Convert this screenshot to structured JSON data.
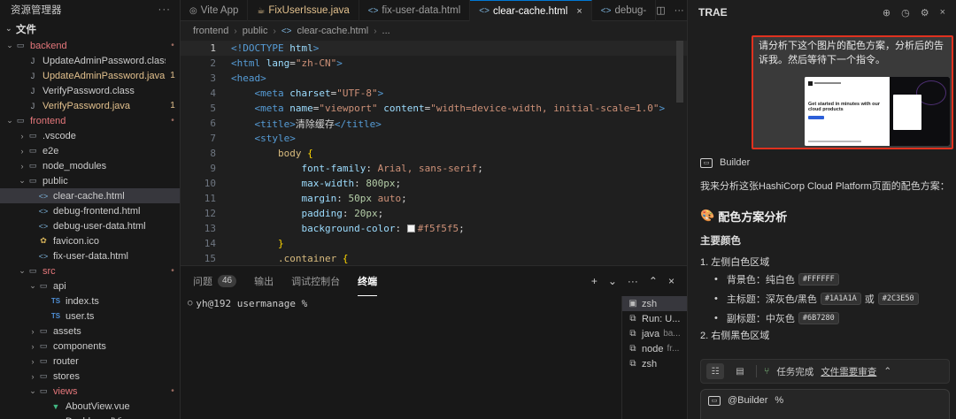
{
  "sidebar": {
    "title": "资源管理器",
    "more": "···",
    "section": "文件",
    "items": [
      {
        "label": "backend",
        "type": "folder",
        "open": true,
        "depth": 0,
        "color": "red",
        "badge": "•"
      },
      {
        "label": "UpdateAdminPassword.class",
        "type": "java",
        "depth": 1,
        "color": "",
        "badge": ""
      },
      {
        "label": "UpdateAdminPassword.java",
        "type": "java",
        "depth": 1,
        "color": "mod",
        "badge": "1"
      },
      {
        "label": "VerifyPassword.class",
        "type": "java",
        "depth": 1,
        "color": "",
        "badge": ""
      },
      {
        "label": "VerifyPassword.java",
        "type": "java",
        "depth": 1,
        "color": "mod",
        "badge": "1"
      },
      {
        "label": "frontend",
        "type": "folder",
        "open": true,
        "depth": 0,
        "color": "red",
        "badge": "•"
      },
      {
        "label": ".vscode",
        "type": "folder",
        "open": false,
        "depth": 1,
        "color": "",
        "badge": ""
      },
      {
        "label": "e2e",
        "type": "folder",
        "open": false,
        "depth": 1,
        "color": "",
        "badge": ""
      },
      {
        "label": "node_modules",
        "type": "folder",
        "open": false,
        "depth": 1,
        "color": "",
        "badge": ""
      },
      {
        "label": "public",
        "type": "folder",
        "open": true,
        "depth": 1,
        "color": "",
        "badge": ""
      },
      {
        "label": "clear-cache.html",
        "type": "html",
        "depth": 2,
        "color": "",
        "badge": "",
        "selected": true
      },
      {
        "label": "debug-frontend.html",
        "type": "html",
        "depth": 2,
        "color": "",
        "badge": ""
      },
      {
        "label": "debug-user-data.html",
        "type": "html",
        "depth": 2,
        "color": "",
        "badge": ""
      },
      {
        "label": "favicon.ico",
        "type": "ico",
        "depth": 2,
        "color": "",
        "badge": ""
      },
      {
        "label": "fix-user-data.html",
        "type": "html",
        "depth": 2,
        "color": "",
        "badge": ""
      },
      {
        "label": "src",
        "type": "folder",
        "open": true,
        "depth": 1,
        "color": "red",
        "badge": "•"
      },
      {
        "label": "api",
        "type": "folder",
        "open": true,
        "depth": 2,
        "color": "",
        "badge": ""
      },
      {
        "label": "index.ts",
        "type": "ts",
        "depth": 3,
        "color": "",
        "badge": ""
      },
      {
        "label": "user.ts",
        "type": "ts",
        "depth": 3,
        "color": "",
        "badge": ""
      },
      {
        "label": "assets",
        "type": "folder",
        "open": false,
        "depth": 2,
        "color": "",
        "badge": ""
      },
      {
        "label": "components",
        "type": "folder",
        "open": false,
        "depth": 2,
        "color": "",
        "badge": ""
      },
      {
        "label": "router",
        "type": "folder",
        "open": false,
        "depth": 2,
        "color": "",
        "badge": ""
      },
      {
        "label": "stores",
        "type": "folder",
        "open": false,
        "depth": 2,
        "color": "",
        "badge": ""
      },
      {
        "label": "views",
        "type": "folder",
        "open": true,
        "depth": 2,
        "color": "red",
        "badge": "•"
      },
      {
        "label": "AboutView.vue",
        "type": "vue",
        "depth": 3,
        "color": "",
        "badge": ""
      },
      {
        "label": "DashboardView.vue",
        "type": "vue",
        "depth": 3,
        "color": "",
        "badge": ""
      }
    ]
  },
  "editor": {
    "tabs": [
      {
        "label": "Vite App",
        "icon": "globe-icon",
        "active": false,
        "modified": false
      },
      {
        "label": "FixUserIssue.java",
        "icon": "java-icon",
        "active": false,
        "modified": true
      },
      {
        "label": "fix-user-data.html",
        "icon": "html-icon",
        "active": false,
        "modified": false
      },
      {
        "label": "clear-cache.html",
        "icon": "html-icon",
        "active": true,
        "modified": false
      },
      {
        "label": "debug-",
        "icon": "html-icon",
        "active": false,
        "modified": false
      }
    ],
    "close_glyph": "×",
    "tab_more": "···",
    "breadcrumb": [
      "frontend",
      "public",
      "clear-cache.html",
      "..."
    ],
    "current_line": 1,
    "lines": [
      {
        "n": "1",
        "html": "<span class='t-tag'>&lt;!DOCTYPE</span> <span class='t-attr'>html</span><span class='t-tag'>&gt;</span>"
      },
      {
        "n": "2",
        "html": "<span class='t-tag'>&lt;html</span> <span class='t-attr'>lang</span>=<span class='t-str'>\"zh-CN\"</span><span class='t-tag'>&gt;</span>"
      },
      {
        "n": "3",
        "html": "<span class='t-tag'>&lt;head&gt;</span>"
      },
      {
        "n": "4",
        "html": "    <span class='t-tag'>&lt;meta</span> <span class='t-attr'>charset</span>=<span class='t-str'>\"UTF-8\"</span><span class='t-tag'>&gt;</span>"
      },
      {
        "n": "5",
        "html": "    <span class='t-tag'>&lt;meta</span> <span class='t-attr'>name</span>=<span class='t-str'>\"viewport\"</span> <span class='t-attr'>content</span>=<span class='t-str'>\"width=device-width, initial-scale=1.0\"</span><span class='t-tag'>&gt;</span>"
      },
      {
        "n": "6",
        "html": "    <span class='t-tag'>&lt;title&gt;</span>清除缓存<span class='t-tag'>&lt;/title&gt;</span>"
      },
      {
        "n": "7",
        "html": "    <span class='t-tag'>&lt;style&gt;</span>"
      },
      {
        "n": "8",
        "html": "        <span class='t-sel'>body</span> <span class='t-br'>{</span>"
      },
      {
        "n": "9",
        "html": "            <span class='t-prop'>font-family</span>: <span class='t-val'>Arial, sans-serif</span>;"
      },
      {
        "n": "10",
        "html": "            <span class='t-prop'>max-width</span>: <span class='t-num'>800px</span>;"
      },
      {
        "n": "11",
        "html": "            <span class='t-prop'>margin</span>: <span class='t-num'>50px</span> <span class='t-val'>auto</span>;"
      },
      {
        "n": "12",
        "html": "            <span class='t-prop'>padding</span>: <span class='t-num'>20px</span>;"
      },
      {
        "n": "13",
        "html": "            <span class='t-prop'>background-color</span>: <span class='swatch'></span><span class='t-val'>#f5f5f5</span>;"
      },
      {
        "n": "14",
        "html": "        <span class='t-br'>}</span>"
      },
      {
        "n": "15",
        "html": "        <span class='t-sel'>.container</span> <span class='t-br'>{</span>"
      }
    ]
  },
  "panel": {
    "tabs": [
      {
        "label": "问题",
        "badge": "46",
        "active": false
      },
      {
        "label": "输出",
        "badge": "",
        "active": false
      },
      {
        "label": "调试控制台",
        "badge": "",
        "active": false
      },
      {
        "label": "终端",
        "badge": "",
        "active": true
      }
    ],
    "actions": {
      "add": "+",
      "dropdown": "⌄",
      "more": "···",
      "maximize": "⌃",
      "close": "×"
    },
    "prompt": "yh@192 usermanage %",
    "terminals": [
      {
        "label": "zsh",
        "sub": "",
        "active": true
      },
      {
        "label": "Run: U...",
        "sub": "",
        "active": false
      },
      {
        "label": "java",
        "sub": "ba...",
        "active": false
      },
      {
        "label": "node",
        "sub": "fr...",
        "active": false
      },
      {
        "label": "zsh",
        "sub": "",
        "active": false
      }
    ]
  },
  "chat": {
    "title": "TRAE",
    "user_message": "请分析下这个图片的配色方案，分析后的告诉我。然后等待下一个指令。",
    "thumbnail_heading": "Get started in minutes with our cloud products",
    "agent_name": "Builder",
    "intro": "我来分析这张HashiCorp Cloud Platform页面的配色方案：",
    "h2": "配色方案分析",
    "h2_icon": "🎨",
    "h3": "主要颜色",
    "section1": "1. 左侧白色区域",
    "bullets": [
      {
        "label": "背景色：纯白色",
        "chips": [
          "#FFFFFF"
        ],
        "joiner": ""
      },
      {
        "label": "主标题：深灰色/黑色",
        "chips": [
          "#1A1A1A",
          "#2C3E50"
        ],
        "joiner": "或"
      },
      {
        "label": "副标题：中灰色",
        "chips": [
          "#6B7280"
        ],
        "joiner": ""
      }
    ],
    "section2": "2. 右侧黑色区域",
    "task_status": "任务完成",
    "task_link": "文件需要审查",
    "mention": "@Builder",
    "mention_icon": "%"
  }
}
